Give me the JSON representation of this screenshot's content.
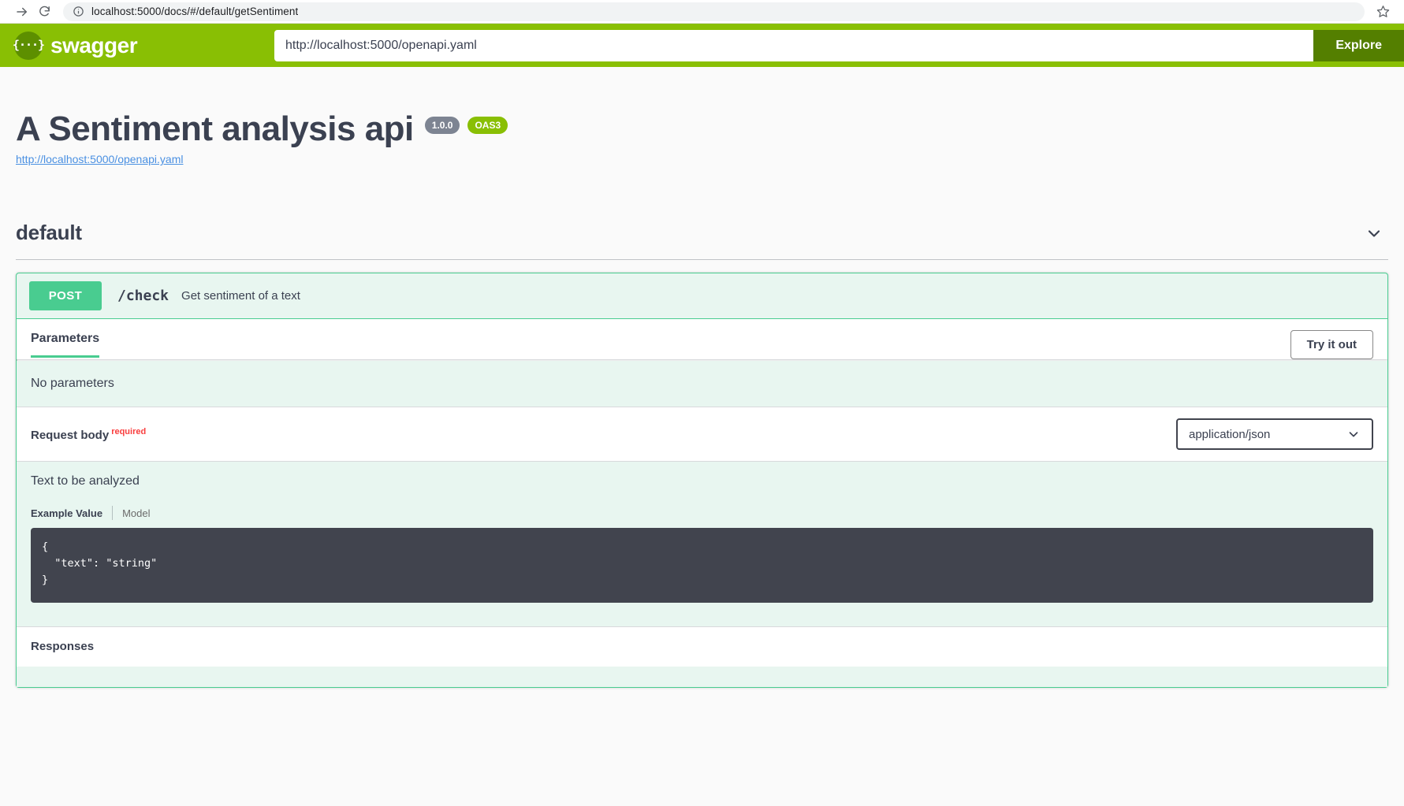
{
  "browser": {
    "url": "localhost:5000/docs/#/default/getSentiment",
    "forward_icon": "forward-arrow-icon",
    "reload_icon": "reload-icon",
    "info_icon": "site-info-icon",
    "star_icon": "bookmark-star-icon"
  },
  "topbar": {
    "logo_glyph": "{···}",
    "logo_text": "swagger",
    "url_value": "http://localhost:5000/openapi.yaml",
    "url_placeholder": "http://localhost:5000/openapi.yaml",
    "explore_label": "Explore",
    "brand_color": "#89bf04",
    "explore_color": "#547f00"
  },
  "info": {
    "title": "A Sentiment analysis api",
    "version_badge": "1.0.0",
    "oas_badge": "OAS3",
    "spec_link": "http://localhost:5000/openapi.yaml"
  },
  "tag": {
    "name": "default",
    "chevron_icon": "chevron-down-icon"
  },
  "operation": {
    "method": "POST",
    "method_color": "#49cc90",
    "path": "/check",
    "summary": "Get sentiment of a text",
    "parameters_tab": "Parameters",
    "try_it_out": "Try it out",
    "no_parameters": "No parameters",
    "request_body_label": "Request body",
    "required_label": "required",
    "content_type": "application/json",
    "content_type_chevron": "chevron-down-icon",
    "body_description": "Text to be analyzed",
    "example_tab": "Example Value",
    "model_tab": "Model",
    "example_code": "{\n  \"text\": \"string\"\n}",
    "responses_label": "Responses"
  }
}
